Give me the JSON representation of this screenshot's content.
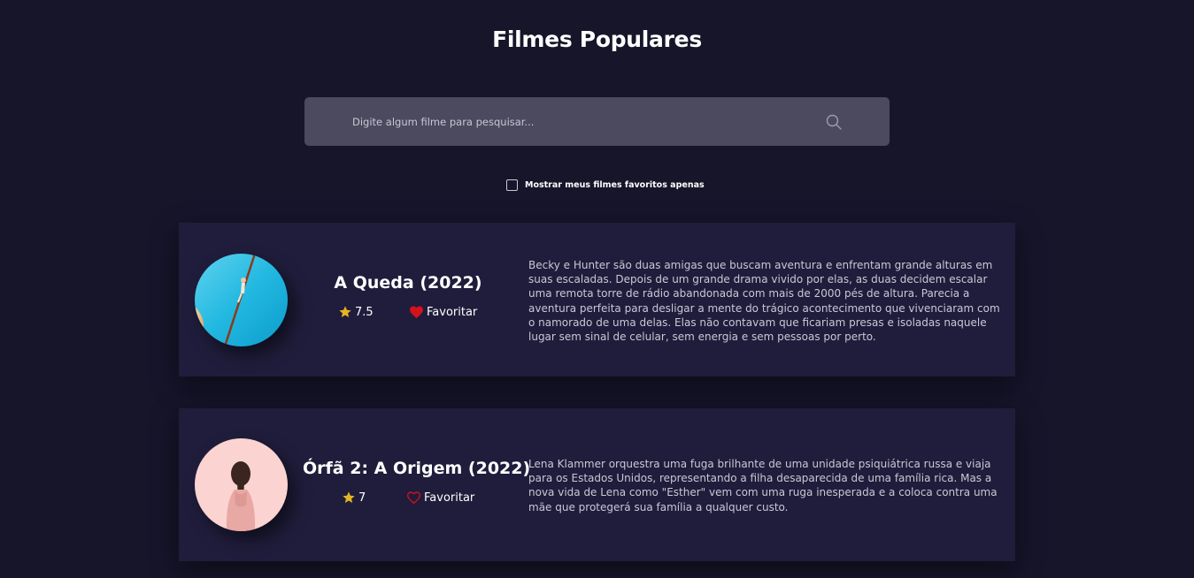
{
  "page": {
    "title": "Filmes Populares"
  },
  "search": {
    "placeholder": "Digite algum filme para pesquisar...",
    "value": "",
    "icon": "search-icon"
  },
  "filter": {
    "label": "Mostrar meus filmes favoritos apenas",
    "checked": false
  },
  "colors": {
    "background": "#16152a",
    "card": "#1f1d3b",
    "search_bg": "#4b4a5e",
    "star": "#e6b422",
    "heart": "#d4121e"
  },
  "movies": [
    {
      "title": "A Queda (2022)",
      "rating": "7.5",
      "favorite_label": "Favoritar",
      "favorited": true,
      "overview": "Becky e Hunter são duas amigas que buscam aventura e enfrentam grande alturas em suas escaladas. Depois de um grande drama vivido por elas, as duas decidem escalar uma remota torre de rádio abandonada com mais de 2000 pés de altura. Parecia a aventura perfeita para desligar a mente do trágico acontecimento que vivenciaram com o namorado de uma delas. Elas não contavam que ficariam presas e isoladas naquele lugar sem sinal de celular, sem energia e sem pessoas por perto."
    },
    {
      "title": "Órfã 2: A Origem (2022)",
      "rating": "7",
      "favorite_label": "Favoritar",
      "favorited": false,
      "overview": "Lena Klammer orquestra uma fuga brilhante de uma unidade psiquiátrica russa e viaja para os Estados Unidos, representando a filha desaparecida de uma família rica. Mas a nova vida de Lena como \"Esther\" vem com uma ruga inesperada e a coloca contra uma mãe que protegerá sua família a qualquer custo."
    }
  ]
}
